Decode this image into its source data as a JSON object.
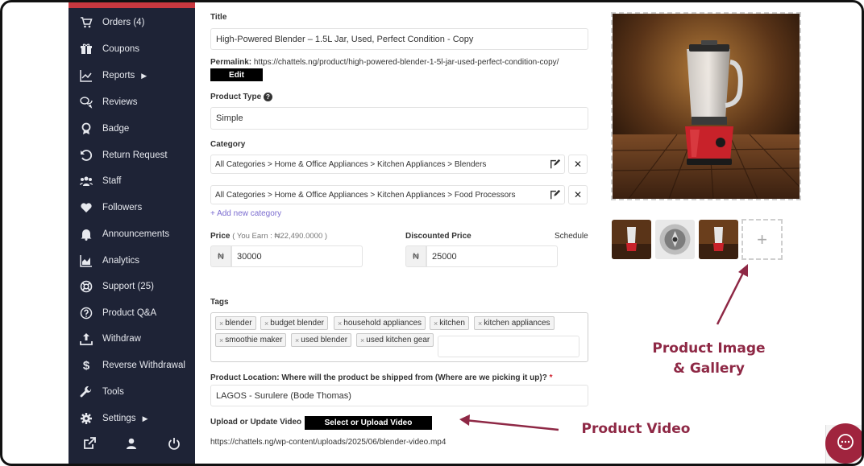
{
  "sidebar": {
    "items": [
      {
        "label": "Orders (4)",
        "icon": "cart-icon",
        "caret": false
      },
      {
        "label": "Coupons",
        "icon": "gift-icon",
        "caret": false
      },
      {
        "label": "Reports",
        "icon": "chart-line-icon",
        "caret": true
      },
      {
        "label": "Reviews",
        "icon": "comments-icon",
        "caret": false
      },
      {
        "label": "Badge",
        "icon": "award-icon",
        "caret": false
      },
      {
        "label": "Return Request",
        "icon": "undo-icon",
        "caret": false
      },
      {
        "label": "Staff",
        "icon": "users-icon",
        "caret": false
      },
      {
        "label": "Followers",
        "icon": "heart-icon",
        "caret": false
      },
      {
        "label": "Announcements",
        "icon": "bell-icon",
        "caret": false
      },
      {
        "label": "Analytics",
        "icon": "area-chart-icon",
        "caret": false
      },
      {
        "label": "Support (25)",
        "icon": "lifebuoy-icon",
        "caret": false
      },
      {
        "label": "Product Q&A",
        "icon": "question-icon",
        "caret": false
      },
      {
        "label": "Withdraw",
        "icon": "upload-icon",
        "caret": false
      },
      {
        "label": "Reverse Withdrawal",
        "icon": "dollar-icon",
        "caret": false
      },
      {
        "label": "Tools",
        "icon": "wrench-icon",
        "caret": false
      },
      {
        "label": "Settings",
        "icon": "cog-icon",
        "caret": true
      }
    ],
    "bottom_icons": [
      "external-link-icon",
      "user-icon",
      "power-icon"
    ],
    "accent": "#c8383f",
    "background": "#1e2336"
  },
  "form": {
    "title_label": "Title",
    "title_value": "High-Powered Blender – 1.5L Jar, Used, Perfect Condition - Copy",
    "permalink_label": "Permalink:",
    "permalink_url": "https://chattels.ng/product/high-powered-blender-1-5l-jar-used-perfect-condition-copy/",
    "edit_label": "Edit",
    "product_type_label": "Product Type",
    "product_type_value": "Simple",
    "category_label": "Category",
    "categories": [
      "All Categories > Home & Office Appliances > Kitchen Appliances > Blenders",
      "All Categories > Home & Office Appliances > Kitchen Appliances > Food Processors"
    ],
    "add_category": "+ Add new category",
    "price_label": "Price",
    "price_earn": "( You Earn : ₦22,490.0000 )",
    "price_currency": "₦",
    "price_value": "30000",
    "discount_label": "Discounted Price",
    "schedule_label": "Schedule",
    "discount_value": "25000",
    "tags_label": "Tags",
    "tags": [
      "blender",
      "budget blender",
      "household appliances",
      "kitchen",
      "kitchen appliances",
      "smoothie maker",
      "used blender",
      "used kitchen gear"
    ],
    "location_label": "Product Location: Where will the product be shipped from (Where are we picking it up)?",
    "required_mark": "*",
    "location_value": "LAGOS - Surulere (Bode Thomas)",
    "video_label": "Upload or Update Video",
    "video_button": "Select or Upload Video",
    "video_url": "https://chattels.ng/wp-content/uploads/2025/06/blender-video.mp4"
  },
  "gallery": {
    "add_symbol": "+"
  },
  "annotations": {
    "image_line1": "Product Image",
    "image_line2": "& Gallery",
    "video": "Product Video",
    "color": "#8e2845"
  }
}
